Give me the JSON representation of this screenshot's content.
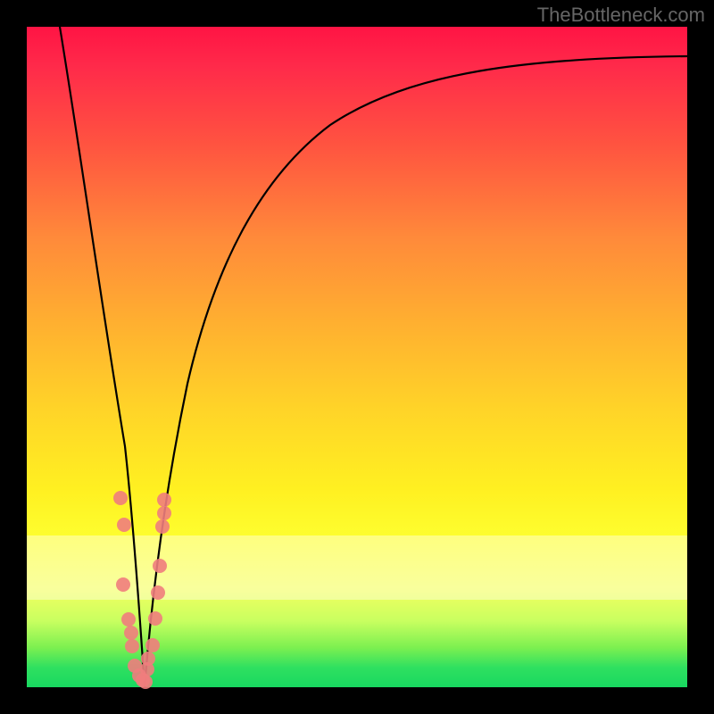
{
  "watermark": "TheBottleneck.com",
  "colors": {
    "dot": "#f07d7d",
    "curve": "#000000",
    "frame": "#000000"
  },
  "chart_data": {
    "type": "line",
    "title": "",
    "xlabel": "",
    "ylabel": "",
    "xlim": [
      0,
      100
    ],
    "ylim": [
      0,
      100
    ],
    "grid": false,
    "legend": false,
    "series": [
      {
        "name": "bottleneck-curve-left",
        "x": [
          5,
          7,
          9,
          11,
          12.5,
          14,
          15,
          15.8,
          16.5,
          17.2,
          17.8
        ],
        "y": [
          100,
          84,
          66,
          48,
          36,
          24,
          16,
          10,
          6,
          2.5,
          0
        ]
      },
      {
        "name": "bottleneck-curve-right",
        "x": [
          17.8,
          19,
          20.5,
          22,
          24,
          27,
          30,
          34,
          40,
          48,
          58,
          70,
          84,
          100
        ],
        "y": [
          0,
          8,
          20,
          32,
          46,
          58,
          66,
          73,
          80,
          85,
          89,
          91.5,
          93.5,
          95
        ]
      }
    ],
    "scatter": {
      "name": "sample-points",
      "points": [
        {
          "x": 14.2,
          "y": 28
        },
        {
          "x": 14.8,
          "y": 24
        },
        {
          "x": 14.6,
          "y": 15
        },
        {
          "x": 15.4,
          "y": 10
        },
        {
          "x": 15.8,
          "y": 8
        },
        {
          "x": 16.0,
          "y": 6
        },
        {
          "x": 16.4,
          "y": 3
        },
        {
          "x": 17.0,
          "y": 1.5
        },
        {
          "x": 17.6,
          "y": 0.8
        },
        {
          "x": 18.0,
          "y": 0.6
        },
        {
          "x": 18.2,
          "y": 2.5
        },
        {
          "x": 18.4,
          "y": 4
        },
        {
          "x": 19.0,
          "y": 6
        },
        {
          "x": 19.4,
          "y": 10
        },
        {
          "x": 19.8,
          "y": 14
        },
        {
          "x": 20.2,
          "y": 18
        },
        {
          "x": 20.6,
          "y": 24
        },
        {
          "x": 20.8,
          "y": 28
        },
        {
          "x": 20.8,
          "y": 26
        }
      ]
    }
  }
}
